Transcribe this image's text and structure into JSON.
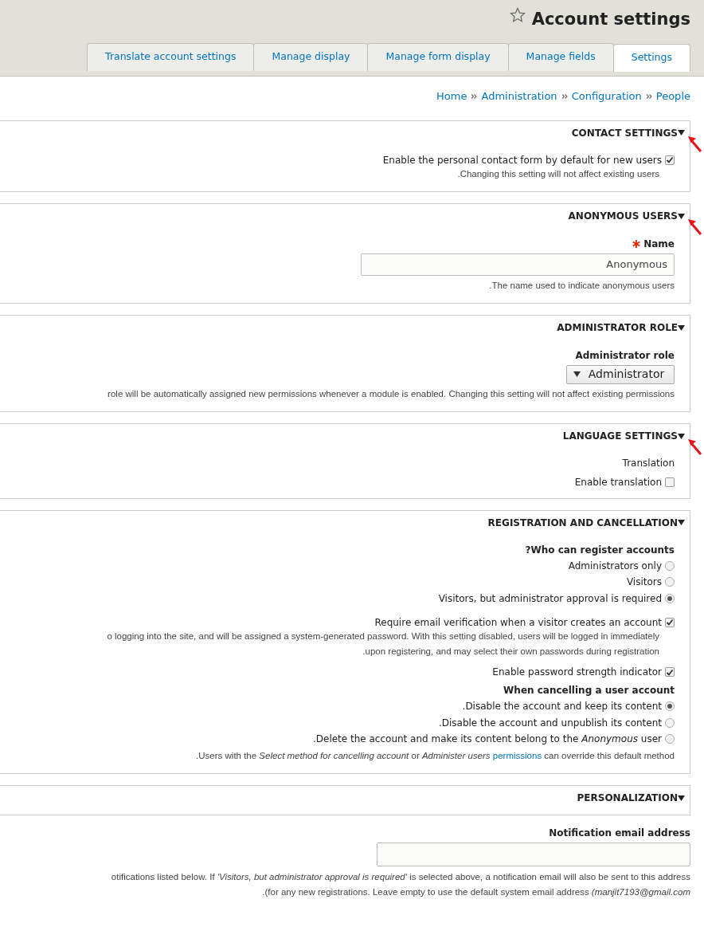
{
  "page": {
    "title": "Account settings"
  },
  "tabs": [
    {
      "label": "Translate account settings",
      "selected": false
    },
    {
      "label": "Manage display",
      "selected": false
    },
    {
      "label": "Manage form display",
      "selected": false
    },
    {
      "label": "Manage fields",
      "selected": false
    },
    {
      "label": "Settings",
      "selected": true
    }
  ],
  "breadcrumb": [
    "Home",
    "Administration",
    "Configuration",
    "People"
  ],
  "sections": [
    {
      "title": "CONTACT SETTINGS",
      "expanded": true,
      "marked": true,
      "items": [
        {
          "kind": "checkbox",
          "label": "Enable the personal contact form by default for new users",
          "checked": true,
          "description": [
            ".Changing this setting will not affect existing users"
          ]
        }
      ]
    },
    {
      "title": "ANONYMOUS USERS",
      "expanded": true,
      "marked": true,
      "items": [
        {
          "kind": "text",
          "label": "Name",
          "required": true,
          "value": "Anonymous",
          "description": [
            ".The name used to indicate anonymous users"
          ]
        }
      ]
    },
    {
      "title": "ADMINISTRATOR ROLE",
      "expanded": true,
      "marked": false,
      "items": [
        {
          "kind": "select",
          "label": "Administrator role",
          "value": "Administrator",
          "description": [
            "role will be automatically assigned new permissions whenever a module is enabled. Changing this setting will not affect existing permissions"
          ]
        }
      ]
    },
    {
      "title": "LANGUAGE SETTINGS",
      "expanded": true,
      "marked": true,
      "items": [
        {
          "kind": "caption",
          "label": "Translation"
        },
        {
          "kind": "checkbox",
          "label": "Enable translation",
          "checked": false
        }
      ]
    },
    {
      "title": "REGISTRATION AND CANCELLATION",
      "expanded": true,
      "marked": false,
      "items": [
        {
          "kind": "radios",
          "label": "?Who can register accounts",
          "options": [
            {
              "label": "Administrators only",
              "selected": false
            },
            {
              "label": "Visitors",
              "selected": false
            },
            {
              "label": "Visitors, but administrator approval is required",
              "selected": true
            }
          ]
        },
        {
          "kind": "checkbox",
          "label": "Require email verification when a visitor creates an account",
          "checked": true,
          "description": [
            "o logging into the site, and will be assigned a system-generated password. With this setting disabled, users will be logged in immediately",
            ".upon registering, and may select their own passwords during registration"
          ]
        },
        {
          "kind": "checkbox",
          "label": "Enable password strength indicator",
          "checked": true
        },
        {
          "kind": "radios",
          "label": "When cancelling a user account",
          "options": [
            {
              "label": ".Disable the account and keep its content",
              "selected": true
            },
            {
              "label": ".Disable the account and unpublish its content",
              "selected": false
            },
            {
              "label": ".Delete the account and make its content belong to the *Anonymous* user",
              "selected": false
            }
          ],
          "note": {
            "before": ".Users with the *Select method for cancelling account* or *Administer users*",
            "link": "permissions",
            "after": "can override this default method"
          }
        }
      ]
    },
    {
      "title": "PERSONALIZATION",
      "expanded": true,
      "marked": false
    }
  ],
  "notification": {
    "label": "Notification email address",
    "description": [
      "otifications listed below. If *'Visitors, but administrator approval is required'* is selected above, a notification email will also be sent to this address",
      ".(for any new registrations. Leave empty to use the default system email address *(manjit7193@gmail.com*"
    ]
  }
}
